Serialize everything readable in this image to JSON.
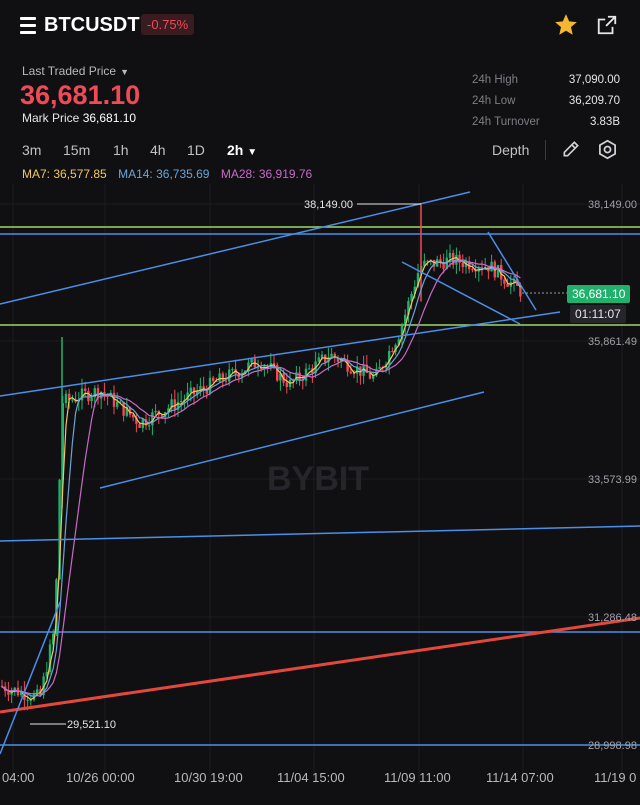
{
  "header": {
    "symbol": "BTCUSDT",
    "change": "-0.75%"
  },
  "quote": {
    "last_traded_label": "Last Traded Price",
    "last_price": "36,681.10",
    "mark_label": "Mark Price",
    "mark_price": "36,681.10",
    "stats": [
      {
        "label": "24h High",
        "value": "37,090.00"
      },
      {
        "label": "24h Low",
        "value": "36,209.70"
      },
      {
        "label": "24h Turnover",
        "value": "3.83B"
      }
    ]
  },
  "toolbar": {
    "intervals": [
      "3m",
      "15m",
      "1h",
      "4h",
      "1D",
      "2h"
    ],
    "active_interval": "2h",
    "depth_label": "Depth"
  },
  "indicators": {
    "ma7": "MA7: 36,577.85",
    "ma14": "MA14: 36,735.69",
    "ma28": "MA28: 36,919.76"
  },
  "chart": {
    "watermark": "BYBIT",
    "price_ticks": [
      "38,149.00",
      "35,861.49",
      "33,573.99",
      "31,286.48",
      "28,998.98"
    ],
    "time_ticks": [
      "04:00",
      "10/26 00:00",
      "10/30 19:00",
      "11/04 15:00",
      "11/09 11:00",
      "11/14 07:00",
      "11/19 0"
    ],
    "high_marker": "38,149.00",
    "low_marker": "29,521.10",
    "last_price_tag": "36,681.10",
    "countdown": "01:11:07"
  },
  "colors": {
    "up": "#20b26c",
    "down": "#f04a57",
    "ma7": "#f0c860",
    "ma14": "#6ba4d6",
    "ma28": "#c86ac8",
    "trendline": "#4a8fe8",
    "horizontal_green": "#9ed86a",
    "red_trend": "#e4473c"
  }
}
